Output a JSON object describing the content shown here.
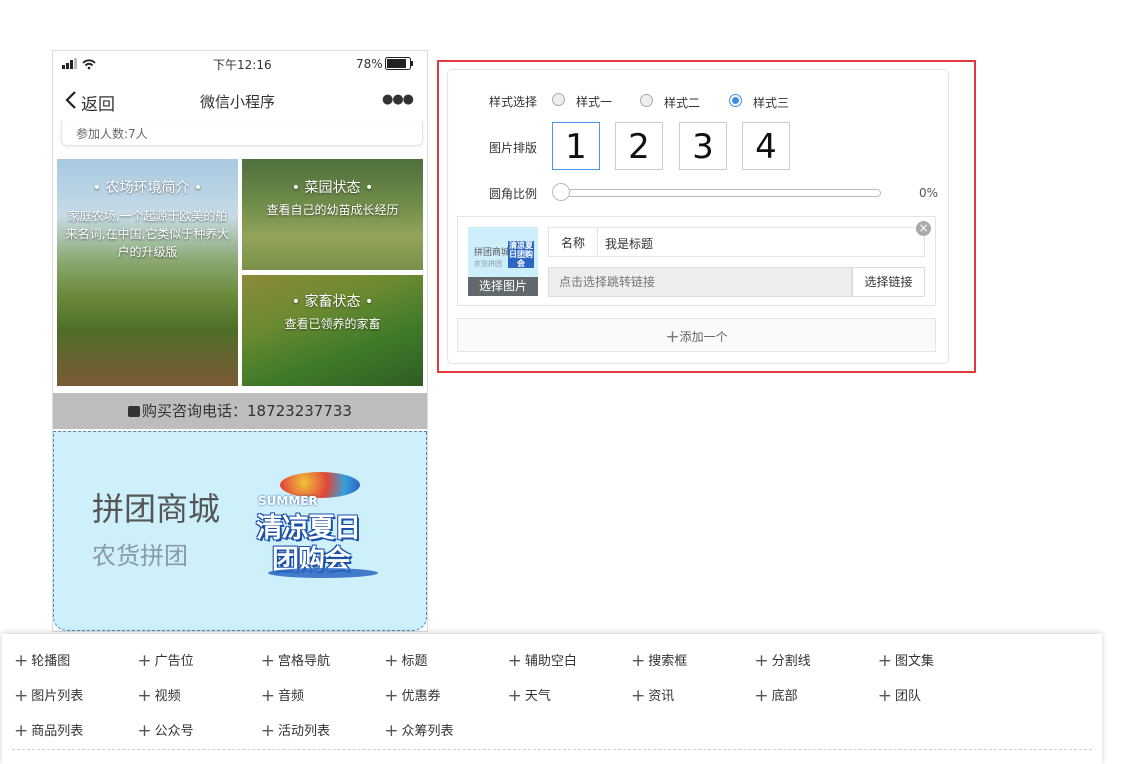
{
  "phone": {
    "status": {
      "time": "下午12:16",
      "battery": "78%"
    },
    "nav": {
      "back": "返回",
      "title": "微信小程序",
      "more": "●●●"
    },
    "card_text": "参加人数:7人",
    "tiles": [
      {
        "title": "• 农场环境简介 •",
        "desc": "家庭农场,一个起源于欧美的舶来名词,在中国,它类似于种养大户的升级版"
      },
      {
        "title": "• 菜园状态 •",
        "desc": "查看自己的幼苗成长经历"
      },
      {
        "title": "• 家畜状态 •",
        "desc": "查看已领养的家畜"
      }
    ],
    "phone_line": "购买咨询电话：18723237733",
    "banner": {
      "title": "拼团商城",
      "subtitle": "农货拼团",
      "logo_en": "SUMMER",
      "logo_line1": "清凉夏日",
      "logo_line2": "团购会"
    }
  },
  "panel": {
    "style_label": "样式选择",
    "styles": [
      "样式一",
      "样式二",
      "样式三"
    ],
    "selected_style": 2,
    "layout_label": "图片排版",
    "layouts": [
      "1",
      "2",
      "3",
      "4"
    ],
    "selected_layout": 0,
    "radius_label": "圆角比例",
    "radius_value": "0%",
    "item": {
      "thumb_text": "拼团商城",
      "thumb_sub": "农货拼团",
      "thumb_logo": "清凉夏日团购会",
      "choose_image": "选择图片",
      "name_label": "名称",
      "name_value": "我是标题",
      "link_placeholder": "点击选择跳转链接",
      "link_button": "选择链接",
      "close": "×"
    },
    "add_label": "添加一个",
    "add_icon": "plus-icon"
  },
  "components": [
    "轮播图",
    "广告位",
    "宫格导航",
    "标题",
    "辅助空白",
    "搜索框",
    "分割线",
    "图文集",
    "图片列表",
    "视频",
    "音频",
    "优惠券",
    "天气",
    "资讯",
    "底部",
    "团队",
    "商品列表",
    "公众号",
    "活动列表",
    "众筹列表"
  ],
  "colors": {
    "accent": "#3d8fe6",
    "highlight_frame": "#e0393e",
    "banner_bg": "#cdf0fb",
    "phone_bar": "#bdbdbd"
  }
}
